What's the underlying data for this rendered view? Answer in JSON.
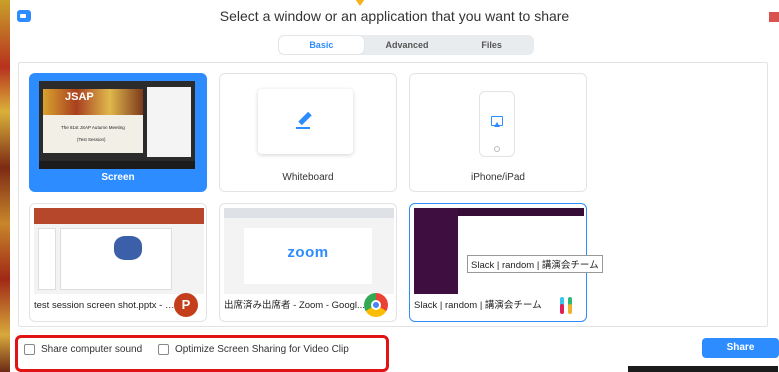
{
  "window": {
    "title": "Select a window or an application that you want to share"
  },
  "tabs": [
    {
      "label": "Basic",
      "active": true
    },
    {
      "label": "Advanced",
      "active": false
    },
    {
      "label": "Files",
      "active": false
    }
  ],
  "basic_tiles": {
    "screen": {
      "label": "Screen",
      "slide_title": "JSAP",
      "slide_line1": "The 81st JSAP Autumn Meeting",
      "slide_line2": "(Test Session)"
    },
    "whiteboard": {
      "label": "Whiteboard"
    },
    "iphone": {
      "label": "iPhone/iPad"
    }
  },
  "app_tiles": {
    "ppt": {
      "label": "test session screen shot.pptx - Po...",
      "badge": "P"
    },
    "chrome": {
      "label": "出席済み出席者 - Zoom - Googl...",
      "content_logo": "zoom"
    },
    "slack": {
      "label": "Slack | random | 講演会チーム",
      "tooltip": "Slack | random | 講演会チーム"
    }
  },
  "options": {
    "share_sound": "Share computer sound",
    "optimize_video": "Optimize Screen Sharing for Video Clip"
  },
  "share_button": "Share",
  "colors": {
    "accent": "#2d8cff",
    "highlight_border": "#e01414"
  }
}
